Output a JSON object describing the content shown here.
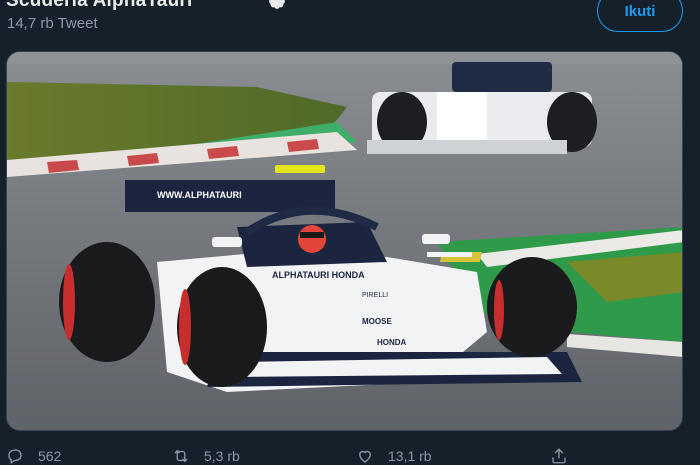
{
  "account": {
    "name": "Scuderia AlphaTauri",
    "tweet_count": "14,7 rb Tweet",
    "follow_label": "Ikuti"
  },
  "media": {
    "car_sponsor_wing": "WWW.ALPHATAURI",
    "car_sponsor_side": "ALPHATAURI HONDA",
    "car_sponsor_nose1": "PIRELLI",
    "car_sponsor_nose2": "MOOSE",
    "car_sponsor_nose3": "HONDA"
  },
  "actions": {
    "replies": "562",
    "retweets": "5,3 rb",
    "likes": "13,1 rb"
  },
  "colors": {
    "background": "#15202b",
    "accent": "#1d9bf0",
    "muted": "#8b98a5"
  }
}
